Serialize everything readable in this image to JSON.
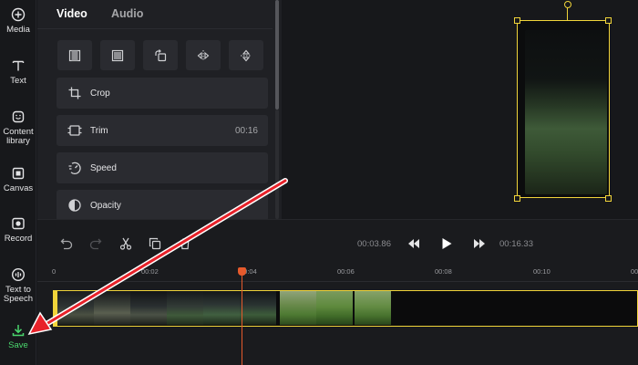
{
  "sidebar": {
    "items": [
      {
        "label": "Media",
        "icon": "plus-circle-icon"
      },
      {
        "label": "Text",
        "icon": "text-t-icon"
      },
      {
        "label": "Content\nlibrary",
        "icon": "sticker-icon"
      },
      {
        "label": "Canvas",
        "icon": "canvas-icon"
      },
      {
        "label": "Record",
        "icon": "record-icon"
      },
      {
        "label": "Text to\nSpeech",
        "icon": "speech-icon"
      },
      {
        "label": "Save",
        "icon": "download-icon"
      }
    ],
    "save_color": "#4ad66d"
  },
  "panel": {
    "tabs": [
      {
        "label": "Video",
        "active": true
      },
      {
        "label": "Audio",
        "active": false
      }
    ],
    "tools": [
      "fill-icon",
      "fit-icon",
      "rotate-icon",
      "flip-horizontal-icon",
      "flip-vertical-icon"
    ],
    "rows": [
      {
        "label": "Crop",
        "icon": "crop-icon",
        "value": ""
      },
      {
        "label": "Trim",
        "icon": "trim-icon",
        "value": "00:16"
      },
      {
        "label": "Speed",
        "icon": "speed-icon",
        "value": ""
      },
      {
        "label": "Opacity",
        "icon": "opacity-icon",
        "value": ""
      }
    ]
  },
  "timeline": {
    "current_time": "00:03.86",
    "total_time": "00:16.33",
    "ruler": [
      "0",
      "00:02",
      "00:04",
      "00:06",
      "00:08",
      "00:10",
      "00:"
    ],
    "accent": "#f0d43a",
    "playhead_color": "#e65a2c"
  },
  "annotation": {
    "arrow_color": "#e8222a"
  }
}
